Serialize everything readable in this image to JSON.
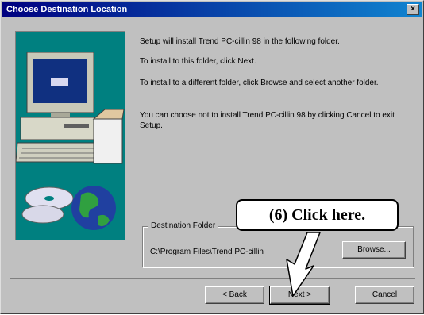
{
  "window": {
    "title": "Choose Destination Location",
    "close_glyph": "×"
  },
  "messages": {
    "line1": "Setup will install Trend PC-cillin 98 in the following folder.",
    "line2": "To install to this folder, click Next.",
    "line3": "To install to a different folder, click Browse and select another folder.",
    "line4": "You can choose not to install Trend PC-cillin 98 by clicking Cancel to exit Setup."
  },
  "destination": {
    "frame_label": "Destination Folder",
    "path": "C:\\Program Files\\Trend PC-cillin",
    "browse_label": "Browse..."
  },
  "buttons": {
    "back": "< Back",
    "next": "Next >",
    "cancel": "Cancel"
  },
  "annotation": {
    "callout": "(6)  Click here."
  },
  "colors": {
    "title_start": "#000080",
    "title_end": "#1084d0",
    "dialog_bg": "#c0c0c0",
    "art_bg": "#008080"
  },
  "icons": {
    "computer": "computer-icon",
    "cd": "cd-icon",
    "globe": "globe-icon",
    "arrow": "callout-arrow-icon"
  }
}
